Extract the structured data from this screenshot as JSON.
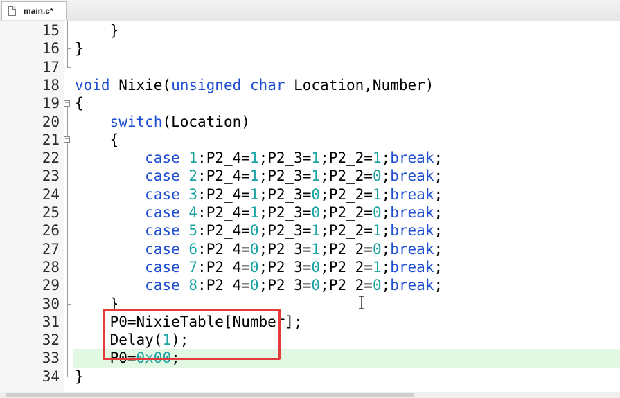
{
  "tab": {
    "label": "main.c*",
    "icon": "file-icon"
  },
  "highlight_color": "#e2f8e2",
  "annotation_color": "#e33b3b",
  "lines": [
    {
      "num": "15",
      "tokens": [
        [
          "p",
          "    }"
        ]
      ]
    },
    {
      "num": "16",
      "tokens": [
        [
          "p",
          "}"
        ]
      ]
    },
    {
      "num": "17",
      "tokens": []
    },
    {
      "num": "18",
      "tokens": [
        [
          "k",
          "void"
        ],
        [
          "p",
          " Nixie("
        ],
        [
          "k",
          "unsigned"
        ],
        [
          "p",
          " "
        ],
        [
          "k",
          "char"
        ],
        [
          "p",
          " Location,Number)"
        ]
      ]
    },
    {
      "num": "19",
      "tokens": [
        [
          "p",
          "{"
        ]
      ]
    },
    {
      "num": "20",
      "tokens": [
        [
          "p",
          "    "
        ],
        [
          "k",
          "switch"
        ],
        [
          "p",
          "(Location)"
        ]
      ]
    },
    {
      "num": "21",
      "tokens": [
        [
          "p",
          "    {"
        ]
      ]
    },
    {
      "num": "22",
      "tokens": [
        [
          "p",
          "        "
        ],
        [
          "k",
          "case"
        ],
        [
          "p",
          " "
        ],
        [
          "n",
          "1"
        ],
        [
          "p",
          ":P2_4="
        ],
        [
          "n",
          "1"
        ],
        [
          "p",
          ";P2_3="
        ],
        [
          "n",
          "1"
        ],
        [
          "p",
          ";P2_2="
        ],
        [
          "n",
          "1"
        ],
        [
          "p",
          ";"
        ],
        [
          "k",
          "break"
        ],
        [
          "p",
          ";"
        ]
      ]
    },
    {
      "num": "23",
      "tokens": [
        [
          "p",
          "        "
        ],
        [
          "k",
          "case"
        ],
        [
          "p",
          " "
        ],
        [
          "n",
          "2"
        ],
        [
          "p",
          ":P2_4="
        ],
        [
          "n",
          "1"
        ],
        [
          "p",
          ";P2_3="
        ],
        [
          "n",
          "1"
        ],
        [
          "p",
          ";P2_2="
        ],
        [
          "n",
          "0"
        ],
        [
          "p",
          ";"
        ],
        [
          "k",
          "break"
        ],
        [
          "p",
          ";"
        ]
      ]
    },
    {
      "num": "24",
      "tokens": [
        [
          "p",
          "        "
        ],
        [
          "k",
          "case"
        ],
        [
          "p",
          " "
        ],
        [
          "n",
          "3"
        ],
        [
          "p",
          ":P2_4="
        ],
        [
          "n",
          "1"
        ],
        [
          "p",
          ";P2_3="
        ],
        [
          "n",
          "0"
        ],
        [
          "p",
          ";P2_2="
        ],
        [
          "n",
          "1"
        ],
        [
          "p",
          ";"
        ],
        [
          "k",
          "break"
        ],
        [
          "p",
          ";"
        ]
      ]
    },
    {
      "num": "25",
      "tokens": [
        [
          "p",
          "        "
        ],
        [
          "k",
          "case"
        ],
        [
          "p",
          " "
        ],
        [
          "n",
          "4"
        ],
        [
          "p",
          ":P2_4="
        ],
        [
          "n",
          "1"
        ],
        [
          "p",
          ";P2_3="
        ],
        [
          "n",
          "0"
        ],
        [
          "p",
          ";P2_2="
        ],
        [
          "n",
          "0"
        ],
        [
          "p",
          ";"
        ],
        [
          "k",
          "break"
        ],
        [
          "p",
          ";"
        ]
      ]
    },
    {
      "num": "26",
      "tokens": [
        [
          "p",
          "        "
        ],
        [
          "k",
          "case"
        ],
        [
          "p",
          " "
        ],
        [
          "n",
          "5"
        ],
        [
          "p",
          ":P2_4="
        ],
        [
          "n",
          "0"
        ],
        [
          "p",
          ";P2_3="
        ],
        [
          "n",
          "1"
        ],
        [
          "p",
          ";P2_2="
        ],
        [
          "n",
          "1"
        ],
        [
          "p",
          ";"
        ],
        [
          "k",
          "break"
        ],
        [
          "p",
          ";"
        ]
      ]
    },
    {
      "num": "27",
      "tokens": [
        [
          "p",
          "        "
        ],
        [
          "k",
          "case"
        ],
        [
          "p",
          " "
        ],
        [
          "n",
          "6"
        ],
        [
          "p",
          ":P2_4="
        ],
        [
          "n",
          "0"
        ],
        [
          "p",
          ";P2_3="
        ],
        [
          "n",
          "1"
        ],
        [
          "p",
          ";P2_2="
        ],
        [
          "n",
          "0"
        ],
        [
          "p",
          ";"
        ],
        [
          "k",
          "break"
        ],
        [
          "p",
          ";"
        ]
      ]
    },
    {
      "num": "28",
      "tokens": [
        [
          "p",
          "        "
        ],
        [
          "k",
          "case"
        ],
        [
          "p",
          " "
        ],
        [
          "n",
          "7"
        ],
        [
          "p",
          ":P2_4="
        ],
        [
          "n",
          "0"
        ],
        [
          "p",
          ";P2_3="
        ],
        [
          "n",
          "0"
        ],
        [
          "p",
          ";P2_2="
        ],
        [
          "n",
          "1"
        ],
        [
          "p",
          ";"
        ],
        [
          "k",
          "break"
        ],
        [
          "p",
          ";"
        ]
      ]
    },
    {
      "num": "29",
      "tokens": [
        [
          "p",
          "        "
        ],
        [
          "k",
          "case"
        ],
        [
          "p",
          " "
        ],
        [
          "n",
          "8"
        ],
        [
          "p",
          ":P2_4="
        ],
        [
          "n",
          "0"
        ],
        [
          "p",
          ";P2_3="
        ],
        [
          "n",
          "0"
        ],
        [
          "p",
          ";P2_2="
        ],
        [
          "n",
          "0"
        ],
        [
          "p",
          ";"
        ],
        [
          "k",
          "break"
        ],
        [
          "p",
          ";"
        ]
      ]
    },
    {
      "num": "30",
      "tokens": [
        [
          "p",
          "    }"
        ]
      ]
    },
    {
      "num": "31",
      "tokens": [
        [
          "p",
          "    P0=NixieTable[Number];"
        ]
      ]
    },
    {
      "num": "32",
      "tokens": [
        [
          "p",
          "    Delay("
        ],
        [
          "n",
          "1"
        ],
        [
          "p",
          ");"
        ]
      ]
    },
    {
      "num": "33",
      "tokens": [
        [
          "p",
          "    P0="
        ],
        [
          "n",
          "0x00"
        ],
        [
          "p",
          ";"
        ]
      ],
      "highlighted": true
    },
    {
      "num": "34",
      "tokens": [
        [
          "p",
          "}"
        ]
      ]
    }
  ]
}
